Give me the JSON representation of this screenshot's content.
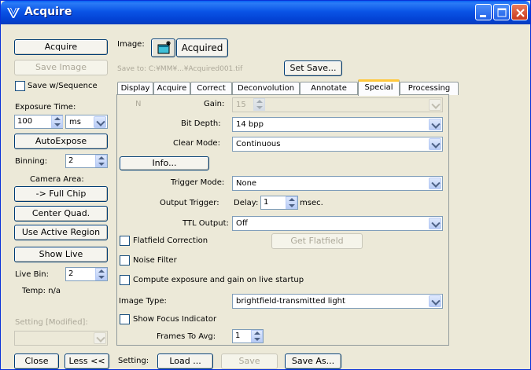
{
  "window": {
    "title": "Acquire"
  },
  "left": {
    "acquire_btn": "Acquire",
    "save_image_btn": "Save Image",
    "save_seq_label": "Save w/Sequence",
    "exposure_label": "Exposure Time:",
    "exposure_value": "100",
    "exposure_unit": "ms",
    "autoexpose_btn": "AutoExpose",
    "binning_label": "Binning:",
    "binning_value": "2",
    "camera_area_label": "Camera Area:",
    "full_chip_btn": "-> Full Chip",
    "center_quad_btn": "Center Quad.",
    "active_region_btn": "Use Active Region",
    "show_live_btn": "Show Live",
    "live_bin_label": "Live Bin:",
    "live_bin_value": "2",
    "temp_label": "Temp: n/a",
    "setting_label": "Setting [Modified]:"
  },
  "image": {
    "label": "Image:",
    "acquired_btn": "Acquired",
    "save_to": "Save to: C:¥MM¥...¥Acquired001.tif",
    "set_save_btn": "Set Save..."
  },
  "tabs": [
    "Display",
    "Acquire",
    "Correct",
    "Deconvolution",
    "Annotate",
    "Special",
    "Processing"
  ],
  "special": {
    "n_label": "N",
    "gain_label": "Gain:",
    "gain_value": "15",
    "bit_depth_label": "Bit Depth:",
    "bit_depth_value": "14 bpp",
    "clear_mode_label": "Clear Mode:",
    "clear_mode_value": "Continuous",
    "info_btn": "Info...",
    "trigger_mode_label": "Trigger Mode:",
    "trigger_mode_value": "None",
    "output_trigger_label": "Output Trigger:",
    "delay_label": "Delay:",
    "delay_value": "1",
    "msec_label": "msec.",
    "ttl_output_label": "TTL Output:",
    "ttl_output_value": "Off",
    "flatfield_label": "Flatfield Correction",
    "get_flatfield_btn": "Get Flatfield",
    "noise_filter_label": "Noise Filter",
    "compute_label": "Compute exposure and gain on live startup",
    "image_type_label": "Image Type:",
    "image_type_value": "brightfield-transmitted light",
    "focus_label": "Show Focus Indicator",
    "frames_label": "Frames To Avg:",
    "frames_value": "1"
  },
  "bottom": {
    "close_btn": "Close",
    "less_btn": "Less <<",
    "setting_label": "Setting:",
    "load_btn": "Load ...",
    "save_btn": "Save",
    "save_as_btn": "Save As..."
  }
}
